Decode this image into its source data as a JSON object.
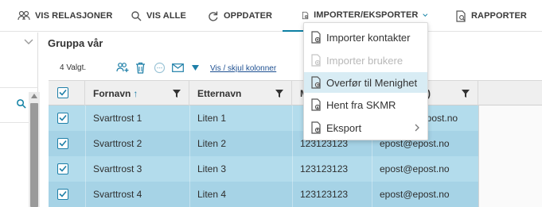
{
  "toolbar": {
    "items": [
      {
        "label": "VIS RELASJONER",
        "icon": "people-icon"
      },
      {
        "label": "VIS ALLE",
        "icon": "search-icon"
      },
      {
        "label": "OPPDATER",
        "icon": "refresh-icon"
      },
      {
        "label": "IMPORTER/EKSPORTER",
        "icon": "import-export-icon"
      },
      {
        "label": "RAPPORTER",
        "icon": "report-icon"
      }
    ]
  },
  "group": {
    "title": "Gruppa vår",
    "selected_count": "4 Valgt.",
    "toggle_columns_link": "Vis / skjul kolonner"
  },
  "table": {
    "headers": [
      "Fornavn",
      "Etternavn",
      "M",
      ")"
    ],
    "sort_indicator": "↑",
    "rows": [
      {
        "fornavn": "Svarttrost 1",
        "etternavn": "Liten 1",
        "mobil": "",
        "epost": "epost.no"
      },
      {
        "fornavn": "Svarttrost 2",
        "etternavn": "Liten 2",
        "mobil": "123123123",
        "epost": "epost@epost.no"
      },
      {
        "fornavn": "Svarttrost 3",
        "etternavn": "Liten 3",
        "mobil": "123123123",
        "epost": "epost@epost.no"
      },
      {
        "fornavn": "Svarttrost 4",
        "etternavn": "Liten 4",
        "mobil": "123123123",
        "epost": "epost@epost.no"
      }
    ]
  },
  "menu": {
    "items": [
      {
        "label": "Importer kontakter",
        "state": "normal"
      },
      {
        "label": "Importer brukere",
        "state": "disabled"
      },
      {
        "label": "Overfør til Menighet",
        "state": "hover"
      },
      {
        "label": "Hent fra SKMR",
        "state": "normal"
      },
      {
        "label": "Eksport",
        "state": "submenu"
      }
    ]
  },
  "colors": {
    "accent": "#0d7fa3",
    "row_selected_a": "#b3dcec",
    "row_selected_b": "#a6d3e6",
    "menu_hover": "#d8ecf4",
    "link": "#1d4f91"
  }
}
